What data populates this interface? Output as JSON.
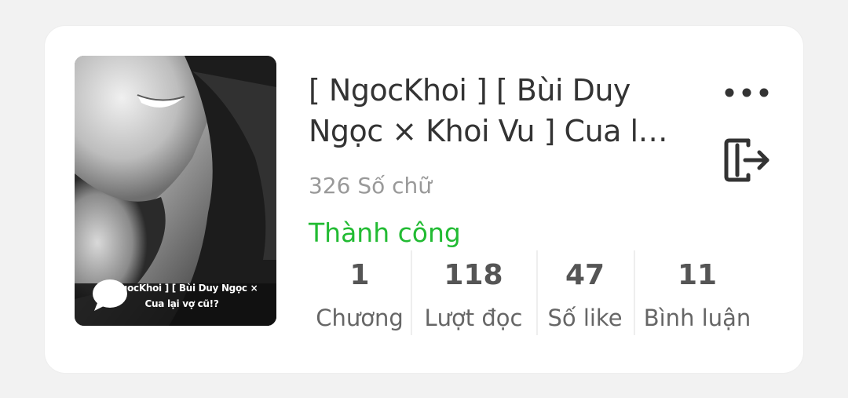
{
  "story": {
    "title": "[ NgocKhoi ] [ Bùi Duy Ngọc × Khoi Vu ] Cua lại vợ cũ!?",
    "word_count": "326 Số chữ",
    "status": "Thành công",
    "cover": {
      "caption_line1": "[ NgocKhoi ] [ Bùi Duy Ngọc × Khoi Vu ]",
      "caption_line2": "Cua lại vợ cũ!?"
    },
    "stats": [
      {
        "value": "1",
        "label": "Chương"
      },
      {
        "value": "118",
        "label": "Lượt đọc"
      },
      {
        "value": "47",
        "label": "Số like"
      },
      {
        "value": "11",
        "label": "Bình luận"
      }
    ]
  },
  "colors": {
    "status": "#22bb33",
    "title": "#333333",
    "muted": "#999999",
    "background": "#f2f2f2",
    "card": "#ffffff"
  },
  "icons": {
    "more": "more-horizontal-icon",
    "exit": "exit-icon",
    "chat": "chat-bubble-icon"
  }
}
